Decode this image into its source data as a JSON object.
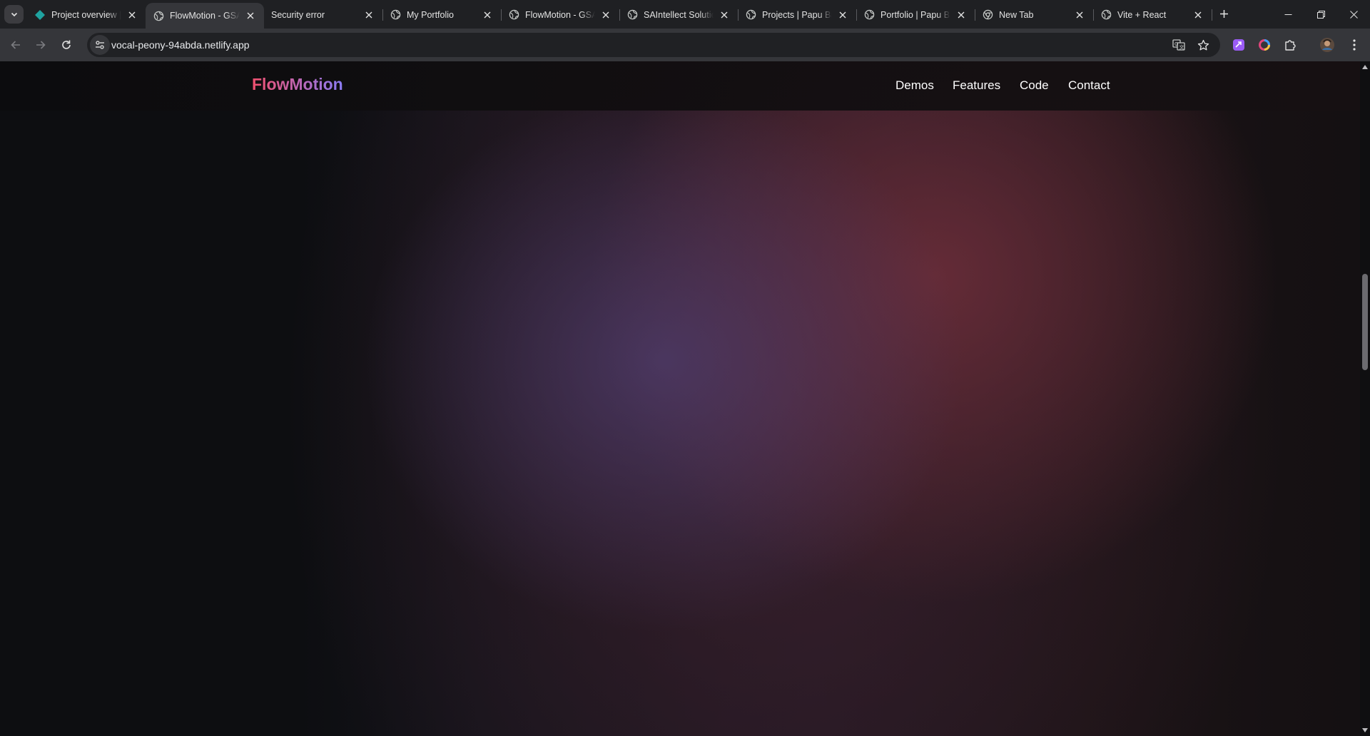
{
  "browser": {
    "tabs": [
      {
        "title": "Project overview |",
        "icon": "diamond-teal-icon",
        "active": false
      },
      {
        "title": "FlowMotion - GSAP",
        "icon": "globe-icon",
        "active": true
      },
      {
        "title": "Security error",
        "icon": "none",
        "active": false
      },
      {
        "title": "My Portfolio",
        "icon": "globe-icon",
        "active": false
      },
      {
        "title": "FlowMotion - GSAP",
        "icon": "globe-icon",
        "active": false
      },
      {
        "title": "SAIntellect Solutions",
        "icon": "globe-icon",
        "active": false
      },
      {
        "title": "Projects | Papu Bar",
        "icon": "globe-icon",
        "active": false
      },
      {
        "title": "Portfolio | Papu Bar",
        "icon": "globe-icon",
        "active": false
      },
      {
        "title": "New Tab",
        "icon": "chrome-icon",
        "active": false
      },
      {
        "title": "Vite + React",
        "icon": "globe-icon",
        "active": false
      }
    ],
    "address": {
      "url": "vocal-peony-94abda.netlify.app"
    },
    "colors": {
      "tabstrip": "#1f2023",
      "toolbar": "#35363a",
      "omnibox": "#202124"
    }
  },
  "page": {
    "logo": "FlowMotion",
    "nav": [
      "Demos",
      "Features",
      "Code",
      "Contact"
    ],
    "colors": {
      "logo_start": "#f0506e",
      "logo_end": "#8b7cf6",
      "background": "#0e0e10"
    }
  }
}
